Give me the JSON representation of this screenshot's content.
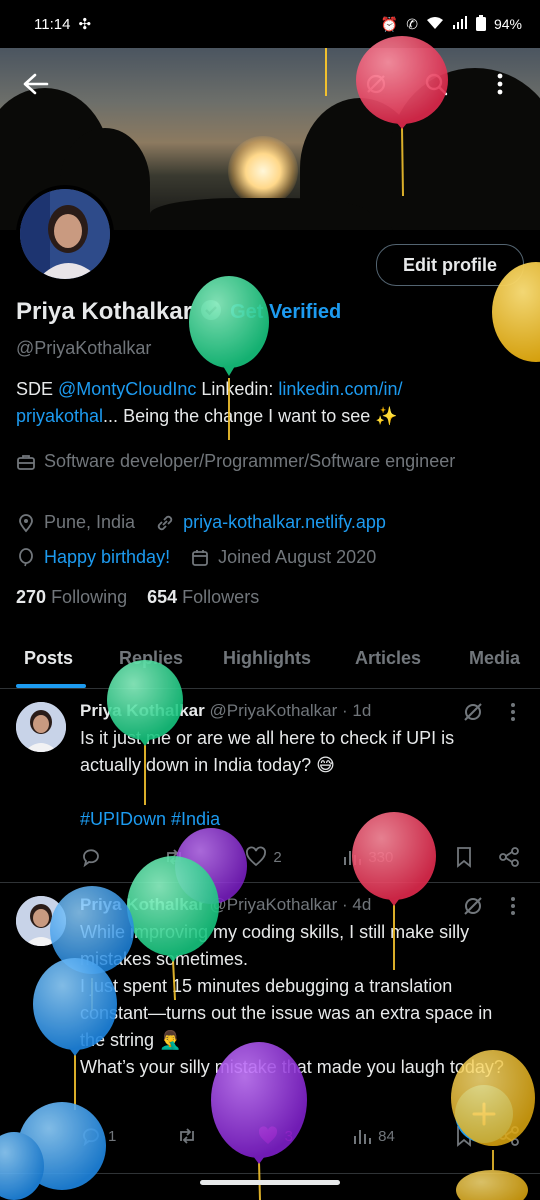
{
  "status": {
    "time": "11:14",
    "battery": "94%"
  },
  "profile": {
    "name": "Priya Kothalkar",
    "get_verified": "Get Verified",
    "handle": "@PriyaKothalkar",
    "edit_profile": "Edit profile",
    "bio": {
      "prefix": "SDE ",
      "mention": "@MontyCloudInc",
      "linkedin_label": " Linkedin: ",
      "linkedin_url": "linkedin.com/in/",
      "linkedin_url_2": "priyakothal",
      "ellipsis": "...",
      "tagline": "  Being the change I want to see ✨"
    },
    "profession": "Software developer/Programmer/Software engineer",
    "location": "Pune, India",
    "website": "priya-kothalkar.netlify.app",
    "birthday": "Happy birthday!",
    "joined": "Joined August 2020",
    "following_count": "270",
    "following_label": "Following",
    "followers_count": "654",
    "followers_label": "Followers"
  },
  "tabs": [
    "Posts",
    "Replies",
    "Highlights",
    "Articles",
    "Media"
  ],
  "posts": [
    {
      "name": "Priya Kothalkar",
      "handle": "@PriyaKothalkar",
      "time": "· 1d",
      "text_1": "Is it just me or are we all here to check if UPI is actually down in India today? 😅",
      "hashtags": "#UPIDown #India",
      "likes": "2",
      "views": "330"
    },
    {
      "name": "Priya Kothalkar",
      "handle": "@PriyaKothalkar",
      "time": "· 4d",
      "text_1": "While improving my coding skills, I still make silly mistakes sometimes.",
      "text_2": "I just spent 15 minutes debugging a translation constant—turns out the issue was an extra space in the string 🤦‍♂️",
      "text_3": "What’s your silly mistake that made you laugh today?",
      "replies": "1",
      "likes": "3",
      "views": "84"
    }
  ],
  "colors": {
    "accent": "#1d9bf0",
    "like_pink": "#f91880",
    "muted": "#71767b",
    "balloon_green": "#2ee39a",
    "balloon_red": "#f0405f",
    "balloon_yellow": "#f2c12e",
    "balloon_blue": "#3aa0f0",
    "balloon_purple": "#9b30e0"
  }
}
